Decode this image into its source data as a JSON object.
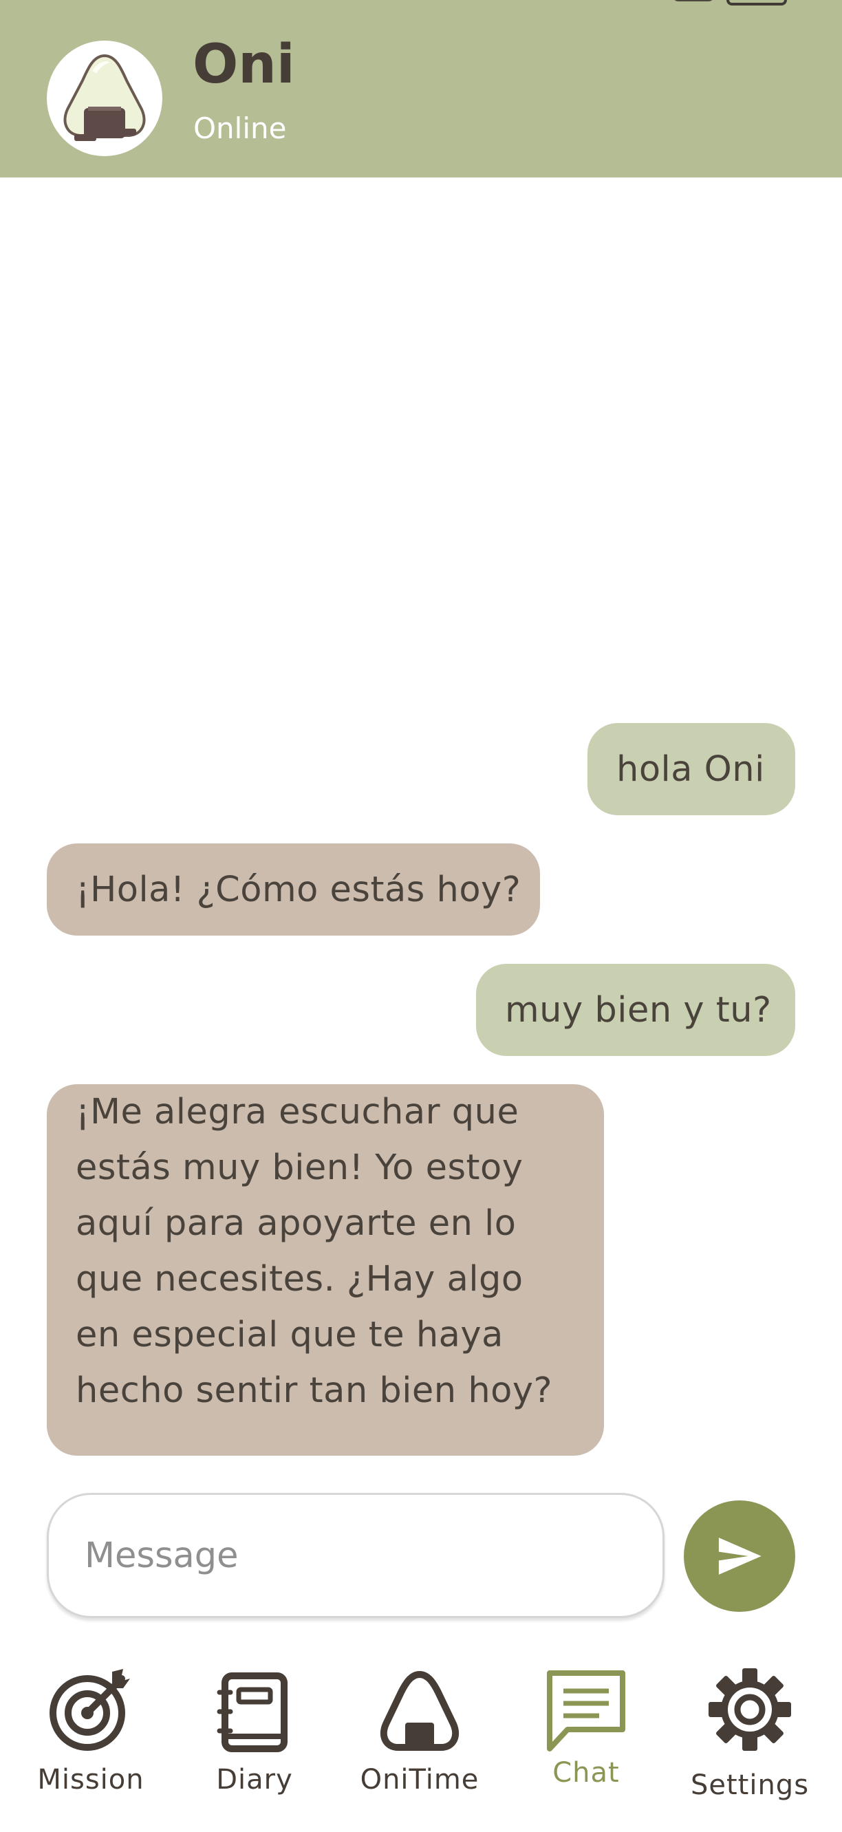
{
  "header": {
    "name": "Oni",
    "status": "Online"
  },
  "messages": [
    {
      "from": "user",
      "text": "hola Oni"
    },
    {
      "from": "oni",
      "text": "¡Hola! ¿Cómo estás hoy?"
    },
    {
      "from": "user",
      "text": "muy bien y tu?"
    },
    {
      "from": "oni",
      "lines": [
        "¡Me alegra escuchar que",
        "estás muy bien! Yo estoy",
        "aquí para apoyarte en lo",
        "que necesites. ¿Hay algo",
        "en especial que te haya",
        "hecho sentir tan bien hoy?"
      ]
    }
  ],
  "composer": {
    "placeholder": "Message",
    "value": ""
  },
  "nav": [
    {
      "label": "Mission",
      "icon": "target-icon",
      "active": false
    },
    {
      "label": "Diary",
      "icon": "notebook-icon",
      "active": false
    },
    {
      "label": "OniTime",
      "icon": "onigiri-icon",
      "active": false
    },
    {
      "label": "Chat",
      "icon": "chat-bubble-icon",
      "active": true
    },
    {
      "label": "Settings",
      "icon": "gear-icon",
      "active": false
    }
  ],
  "colors": {
    "header_bg": "#b5bd95",
    "user_bubble": "#c9d0b1",
    "bot_bubble": "#cbbcae",
    "accent": "#8b9655",
    "text_dark": "#453d36"
  }
}
